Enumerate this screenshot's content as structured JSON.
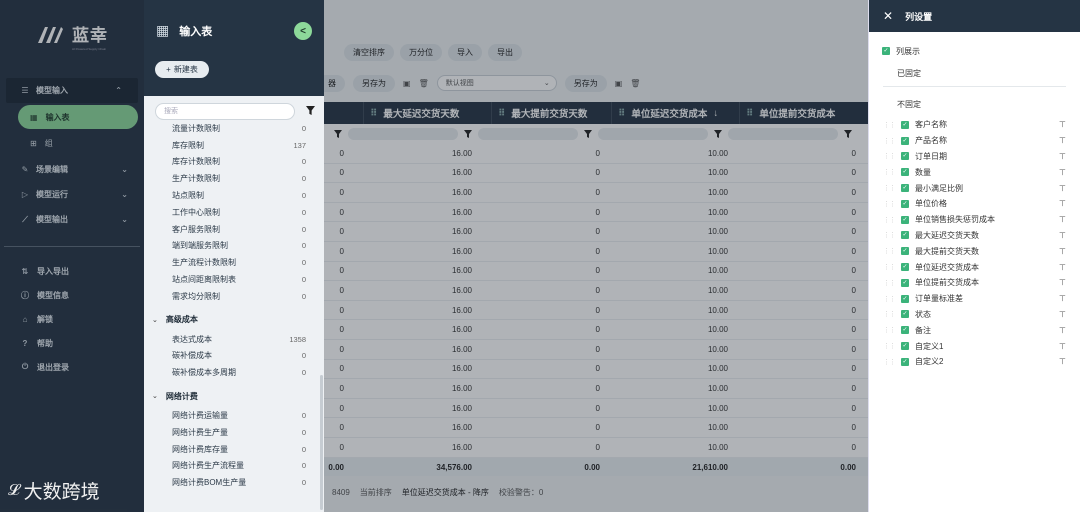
{
  "app": {
    "logo_text": "蓝幸",
    "logo_sub": "AI Powered Supply Chain",
    "watermark": "大数跨境"
  },
  "sidebar": {
    "items": [
      {
        "label": "模型输入",
        "icon": "list-icon",
        "open": true
      },
      {
        "label": "场景编辑",
        "icon": "edit-icon"
      },
      {
        "label": "模型运行",
        "icon": "play-icon"
      },
      {
        "label": "模型输出",
        "icon": "chart-icon"
      }
    ],
    "sub_items": [
      {
        "label": "输入表",
        "active": true
      },
      {
        "label": "组"
      }
    ],
    "bottom": [
      {
        "label": "导入导出",
        "icon": "import-export-icon"
      },
      {
        "label": "模型信息",
        "icon": "info-icon"
      },
      {
        "label": "解锁",
        "icon": "lock-icon"
      },
      {
        "label": "帮助",
        "icon": "help-icon"
      },
      {
        "label": "退出登录",
        "icon": "logout-icon"
      }
    ]
  },
  "tables_panel": {
    "title": "输入表",
    "collapse_label": "<",
    "new_label": "新建表",
    "search_placeholder": "搜索",
    "rows1": [
      {
        "name": "流量计数限制",
        "count": "0"
      },
      {
        "name": "库存限制",
        "count": "137"
      },
      {
        "name": "库存计数限制",
        "count": "0"
      },
      {
        "name": "生产计数限制",
        "count": "0"
      },
      {
        "name": "站点限制",
        "count": "0"
      },
      {
        "name": "工作中心限制",
        "count": "0"
      },
      {
        "name": "客户服务限制",
        "count": "0"
      },
      {
        "name": "端到端服务限制",
        "count": "0"
      },
      {
        "name": "生产流程计数限制",
        "count": "0"
      },
      {
        "name": "站点间距离限制表",
        "count": "0"
      },
      {
        "name": "需求均分限制",
        "count": "0"
      }
    ],
    "group2": "高级成本",
    "rows2": [
      {
        "name": "表达式成本",
        "count": "1358"
      },
      {
        "name": "碳补偿成本",
        "count": "0"
      },
      {
        "name": "碳补偿成本多周期",
        "count": "0"
      }
    ],
    "group3": "网络计费",
    "rows3": [
      {
        "name": "网络计费运输量",
        "count": "0"
      },
      {
        "name": "网络计费生产量",
        "count": "0"
      },
      {
        "name": "网络计费库存量",
        "count": "0"
      },
      {
        "name": "网络计费生产流程量",
        "count": "0"
      },
      {
        "name": "网络计费BOM生产量",
        "count": "0"
      }
    ]
  },
  "grid": {
    "toolbar": [
      "清空排序",
      "万分位",
      "导入",
      "导出"
    ],
    "toolbar_partial": "",
    "save_as_1": "另存为",
    "save_as_2": "另存为",
    "filter_partial": "器",
    "view_select": "默认视图",
    "columns": [
      "最大延迟交货天数",
      "最大提前交货天数",
      "单位延迟交货成本",
      "单位提前交货成本"
    ],
    "rows": [
      [
        "0",
        "16.00",
        "0",
        "10.00",
        "0"
      ],
      [
        "0",
        "16.00",
        "0",
        "10.00",
        "0"
      ],
      [
        "0",
        "16.00",
        "0",
        "10.00",
        "0"
      ],
      [
        "0",
        "16.00",
        "0",
        "10.00",
        "0"
      ],
      [
        "0",
        "16.00",
        "0",
        "10.00",
        "0"
      ],
      [
        "0",
        "16.00",
        "0",
        "10.00",
        "0"
      ],
      [
        "0",
        "16.00",
        "0",
        "10.00",
        "0"
      ],
      [
        "0",
        "16.00",
        "0",
        "10.00",
        "0"
      ],
      [
        "0",
        "16.00",
        "0",
        "10.00",
        "0"
      ],
      [
        "0",
        "16.00",
        "0",
        "10.00",
        "0"
      ],
      [
        "0",
        "16.00",
        "0",
        "10.00",
        "0"
      ],
      [
        "0",
        "16.00",
        "0",
        "10.00",
        "0"
      ],
      [
        "0",
        "16.00",
        "0",
        "10.00",
        "0"
      ],
      [
        "0",
        "16.00",
        "0",
        "10.00",
        "0"
      ],
      [
        "0",
        "16.00",
        "0",
        "10.00",
        "0"
      ],
      [
        "0",
        "16.00",
        "0",
        "10.00",
        "0"
      ]
    ],
    "totals": [
      "0.00",
      "34,576.00",
      "0.00",
      "21,610.00",
      "0.00"
    ],
    "status": {
      "count": "8409",
      "sort_label": "当前排序",
      "sort_value": "单位延迟交货成本 - 降序",
      "check_label": "校验警告：0"
    }
  },
  "column_settings": {
    "title": "列设置",
    "show_label": "列展示",
    "pinned_label": "已固定",
    "unpinned_label": "不固定",
    "columns": [
      "客户名称",
      "产品名称",
      "订单日期",
      "数量",
      "最小满足比例",
      "单位价格",
      "单位销售损失惩罚成本",
      "最大延迟交货天数",
      "最大提前交货天数",
      "单位延迟交货成本",
      "单位提前交货成本",
      "订单量标准差",
      "状态",
      "备注",
      "自定义1",
      "自定义2"
    ]
  },
  "colors": {
    "sidebar_bg": "#253444",
    "accent_green": "#8dd99a",
    "checkbox_green": "#3bb37a"
  }
}
